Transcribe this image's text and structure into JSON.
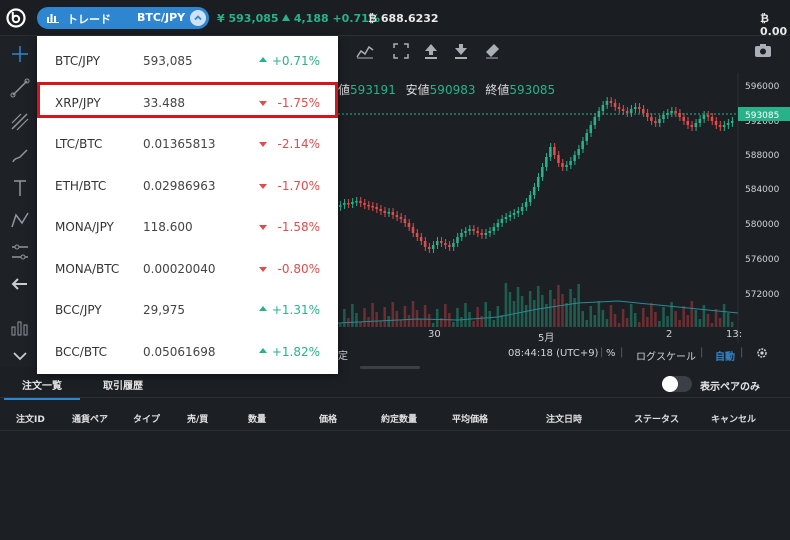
{
  "topbar": {
    "trade_label": "トレード",
    "pair": "BTC/JPY",
    "ticker_price": "¥ 593,085",
    "ticker_change": "4,188 +0.71%",
    "ticker_btc": "688.6232",
    "right_balance": "0.00"
  },
  "dropdown": {
    "rows": [
      {
        "symbol": "BTC/JPY",
        "price": "593,085",
        "change": "+0.71%",
        "dir": "up"
      },
      {
        "symbol": "XRP/JPY",
        "price": "33.488",
        "change": "-1.75%",
        "dir": "down"
      },
      {
        "symbol": "LTC/BTC",
        "price": "0.01365813",
        "change": "-2.14%",
        "dir": "down"
      },
      {
        "symbol": "ETH/BTC",
        "price": "0.02986963",
        "change": "-1.70%",
        "dir": "down"
      },
      {
        "symbol": "MONA/JPY",
        "price": "118.600",
        "change": "-1.58%",
        "dir": "down"
      },
      {
        "symbol": "MONA/BTC",
        "price": "0.00020040",
        "change": "-0.80%",
        "dir": "down"
      },
      {
        "symbol": "BCC/JPY",
        "price": "29,975",
        "change": "+1.31%",
        "dir": "up"
      },
      {
        "symbol": "BCC/BTC",
        "price": "0.05061698",
        "change": "+1.82%",
        "dir": "up"
      }
    ]
  },
  "chart": {
    "ohlc": {
      "high_label": "値",
      "high_value": "593191",
      "low_label": "安値",
      "low_value": "590983",
      "close_label": "終値",
      "close_value": "593085"
    },
    "price_axis": [
      "596000",
      "592000",
      "588000",
      "584000",
      "580000",
      "576000",
      "572000"
    ],
    "current_price": "593085",
    "time_axis": [
      "30",
      "5月",
      "2",
      "13:"
    ],
    "footer": {
      "time": "08:44:18 (UTC+9)",
      "percent": "%",
      "log": "ログスケール",
      "auto": "自動",
      "left_char": "定"
    }
  },
  "bottom": {
    "tabs": [
      "注文一覧",
      "取引履歴"
    ],
    "toggle_label": "表示ペアのみ",
    "columns": [
      "注文ID",
      "通貨ペア",
      "タイプ",
      "売/買",
      "数量",
      "価格",
      "約定数量",
      "平均価格",
      "注文日時",
      "ステータス",
      "キャンセル"
    ]
  },
  "colors": {
    "accent": "#2f86d0",
    "up": "#27b28a",
    "down": "#e24b4b",
    "highlight": "#d6141b",
    "background": "#1c2025"
  }
}
